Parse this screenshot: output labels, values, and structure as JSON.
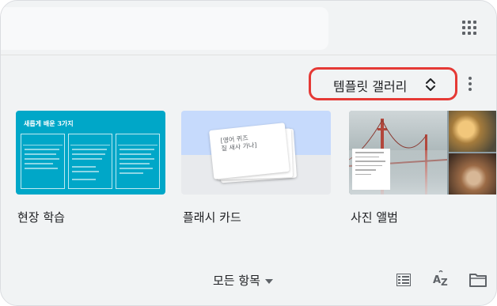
{
  "toolbar": {
    "apps_icon": "apps-grid-icon",
    "template_gallery_label": "템플릿 갤러리",
    "unfold_icon": "unfold-more-icon",
    "more_icon": "more-vertical-icon",
    "highlight_color": "#e53935"
  },
  "templates": [
    {
      "label": "현장 학습",
      "thumb_title": "새롭게 배운 3가지",
      "thumb_color": "#00a7c8"
    },
    {
      "label": "플래시 카드",
      "thumb_text_line1": "[영어 퀴즈",
      "thumb_text_line2": "질 새사 가나]"
    },
    {
      "label": "사진 앨범"
    }
  ],
  "bottom_bar": {
    "filter_label": "모든 항목",
    "filter_caret_icon": "arrow-drop-down-icon",
    "list_view_icon": "list-view-icon",
    "sort_icon": "sort-az-icon",
    "folder_icon": "folder-icon"
  },
  "colors": {
    "background": "#f1f3f4",
    "accent_blue": "#00a7c8",
    "text": "#202124",
    "icon": "#5f6368"
  }
}
